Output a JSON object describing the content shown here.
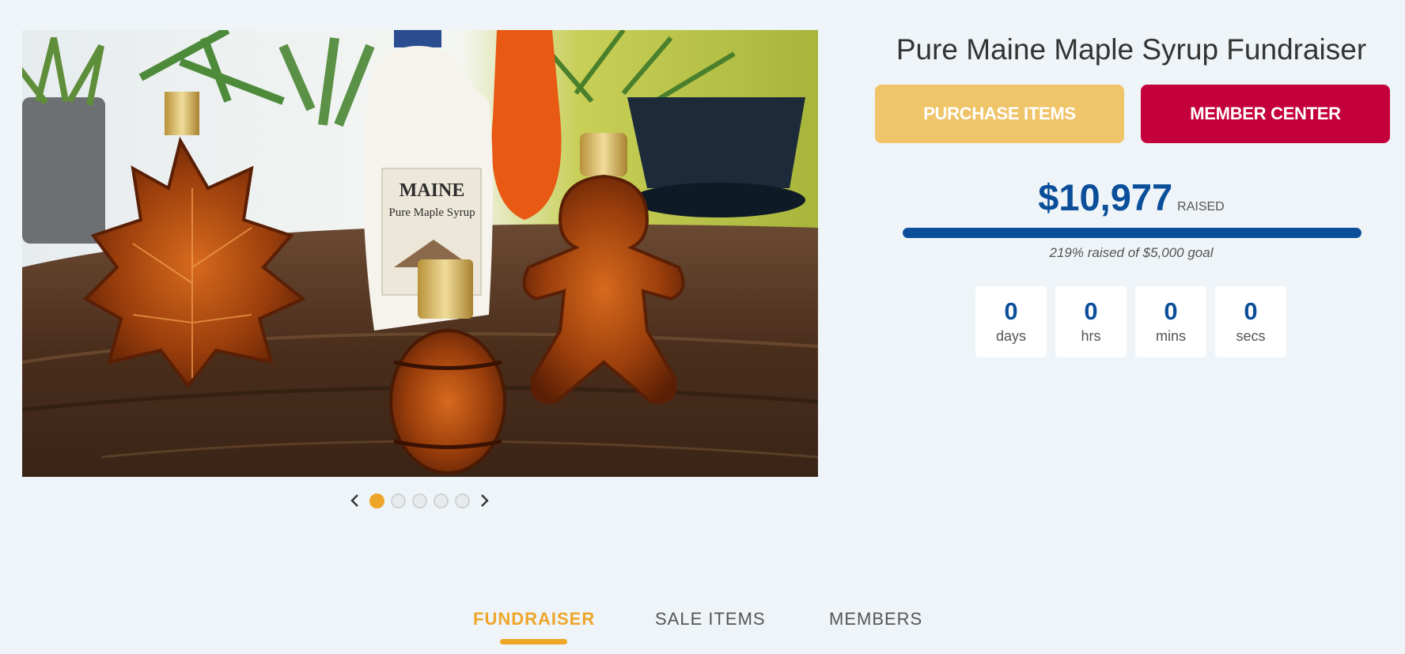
{
  "fundraiser": {
    "title": "Pure Maine Maple Syrup Fundraiser",
    "purchase_label": "PURCHASE ITEMS",
    "member_label": "MEMBER CENTER",
    "raised_amount": "$10,977",
    "raised_label": "RAISED",
    "progress_percent": 100,
    "goal_text": "219% raised of $5,000 goal"
  },
  "hero": {
    "jug_brand": "MAINE",
    "jug_subtitle": "Pure Maple Syrup"
  },
  "carousel": {
    "slide_count": 5,
    "active_index": 0
  },
  "countdown": [
    {
      "value": "0",
      "unit": "days"
    },
    {
      "value": "0",
      "unit": "hrs"
    },
    {
      "value": "0",
      "unit": "mins"
    },
    {
      "value": "0",
      "unit": "secs"
    }
  ],
  "tabs": [
    {
      "label": "FUNDRAISER",
      "active": true
    },
    {
      "label": "SALE ITEMS",
      "active": false
    },
    {
      "label": "MEMBERS",
      "active": false
    }
  ],
  "colors": {
    "accent_orange": "#eea62a",
    "primary_blue": "#0b4f9a",
    "purchase_button": "#f0c469",
    "member_button": "#c4003c"
  }
}
